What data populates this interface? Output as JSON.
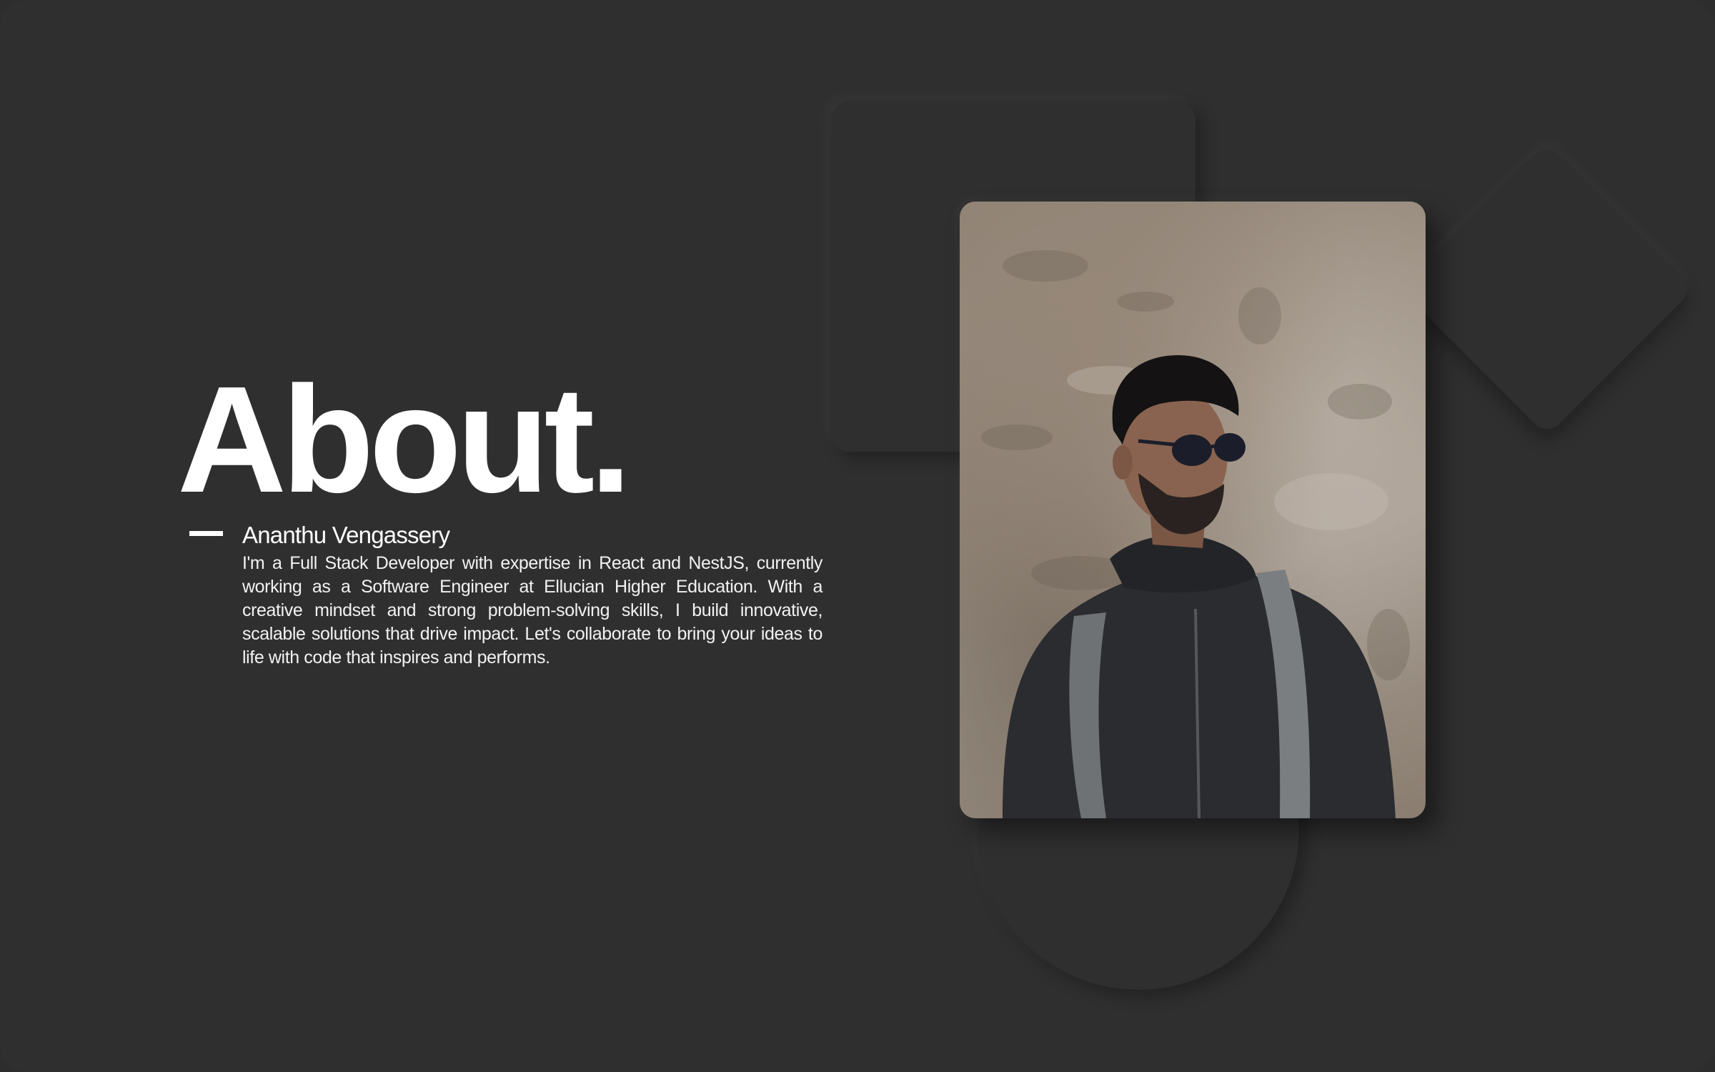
{
  "about": {
    "heading": "About.",
    "name": "Ananthu Vengassery",
    "bio": "I'm a Full Stack Developer with expertise in React and NestJS, currently working as a Software Engineer at Ellucian Higher Education. With a creative mindset and strong problem-solving skills, I build innovative, scalable solutions that drive impact. Let's collaborate to bring your ideas to life with code that inspires and performs."
  },
  "colors": {
    "background": "#2f2f2f",
    "text": "#ffffff"
  },
  "photo": {
    "icon": "profile-photo"
  }
}
